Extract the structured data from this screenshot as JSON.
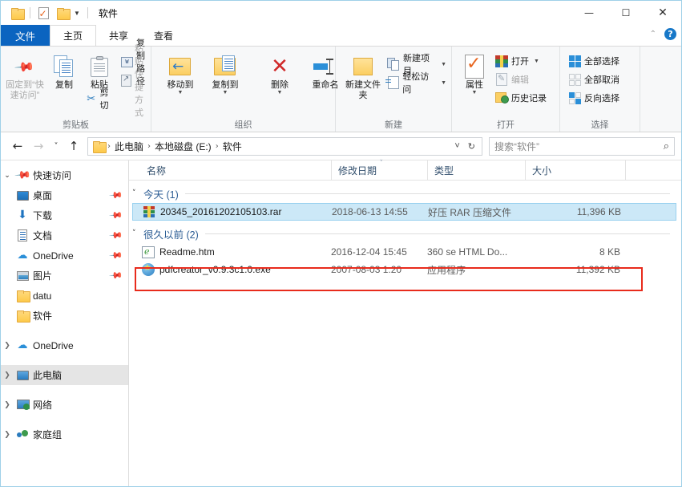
{
  "window": {
    "title": "软件",
    "quick_access": [
      {
        "name": "folder-icon",
        "label": "文件夹"
      },
      {
        "name": "properties-icon",
        "label": "属性"
      },
      {
        "name": "folder-icon-2",
        "label": "新建文件夹"
      }
    ],
    "controls": {
      "minimize": "—",
      "maximize": "☐",
      "close": "✕"
    }
  },
  "tabs": [
    {
      "label": "文件",
      "kind": "file"
    },
    {
      "label": "主页",
      "kind": "active"
    },
    {
      "label": "共享",
      "kind": "normal"
    },
    {
      "label": "查看",
      "kind": "normal"
    }
  ],
  "tab_right": {
    "collapse": "⌃",
    "help": "?"
  },
  "ribbon": {
    "groups": [
      {
        "title": "剪贴板",
        "big": [
          {
            "label": "固定到“快速访问”",
            "icon": "pin-icon",
            "disabled": true
          },
          {
            "label": "复制",
            "icon": "copy-icon",
            "disabled": false
          },
          {
            "label": "粘贴",
            "icon": "paste-icon",
            "disabled": false
          }
        ],
        "small": [
          {
            "label": "复制路径",
            "icon": "copy-path-icon",
            "disabled": false
          },
          {
            "label": "粘贴快捷方式",
            "icon": "paste-shortcut-icon",
            "disabled": true
          }
        ],
        "extra": [
          {
            "label": "剪切",
            "icon": "scissors-icon",
            "disabled": false
          }
        ]
      },
      {
        "title": "组织",
        "big": [
          {
            "label": "移动到",
            "icon": "move-to-icon",
            "dropdown": true
          },
          {
            "label": "复制到",
            "icon": "copy-to-icon",
            "dropdown": true
          },
          {
            "label": "删除",
            "icon": "delete-icon",
            "dropdown": true
          },
          {
            "label": "重命名",
            "icon": "rename-icon",
            "dropdown": false
          }
        ]
      },
      {
        "title": "新建",
        "big": [
          {
            "label": "新建文件夹",
            "icon": "new-folder-icon"
          }
        ],
        "small": [
          {
            "label": "新建项目",
            "icon": "new-item-icon",
            "dropdown": true
          },
          {
            "label": "轻松访问",
            "icon": "easy-access-icon",
            "dropdown": true
          }
        ]
      },
      {
        "title": "打开",
        "big": [
          {
            "label": "属性",
            "icon": "properties-icon",
            "dropdown": true
          }
        ],
        "small": [
          {
            "label": "打开",
            "icon": "open-archive-icon",
            "dropdown": true,
            "disabled": false
          },
          {
            "label": "编辑",
            "icon": "edit-icon",
            "disabled": true
          },
          {
            "label": "历史记录",
            "icon": "history-icon",
            "disabled": false
          }
        ]
      },
      {
        "title": "选择",
        "small": [
          {
            "label": "全部选择",
            "icon": "select-all-icon"
          },
          {
            "label": "全部取消",
            "icon": "select-none-icon"
          },
          {
            "label": "反向选择",
            "icon": "invert-selection-icon"
          }
        ]
      }
    ]
  },
  "addressbar": {
    "back": "←",
    "forward": "→",
    "recent": "˅",
    "up": "↑",
    "breadcrumbs": [
      "此电脑",
      "本地磁盘 (E:)",
      "软件"
    ],
    "separator": "›",
    "dropdown": "˅",
    "refresh": "↻",
    "search_placeholder": "搜索“软件”",
    "search_value": "",
    "search_icon": "⌕"
  },
  "sidebar": {
    "items": [
      {
        "label": "快速访问",
        "icon": "quick-access-icon",
        "expander": "open",
        "indent": 0,
        "pinned": false,
        "selected": false
      },
      {
        "label": "桌面",
        "icon": "desktop-icon",
        "expander": "none",
        "indent": 1,
        "pinned": true,
        "selected": false
      },
      {
        "label": "下载",
        "icon": "downloads-icon",
        "expander": "none",
        "indent": 1,
        "pinned": true,
        "selected": false
      },
      {
        "label": "文档",
        "icon": "documents-icon",
        "expander": "none",
        "indent": 1,
        "pinned": true,
        "selected": false
      },
      {
        "label": "OneDrive",
        "icon": "onedrive-icon",
        "expander": "none",
        "indent": 1,
        "pinned": true,
        "selected": false
      },
      {
        "label": "图片",
        "icon": "pictures-icon",
        "expander": "none",
        "indent": 1,
        "pinned": true,
        "selected": false
      },
      {
        "label": "datu",
        "icon": "folder-icon",
        "expander": "none",
        "indent": 1,
        "pinned": false,
        "selected": false
      },
      {
        "label": "软件",
        "icon": "folder-icon",
        "expander": "none",
        "indent": 1,
        "pinned": false,
        "selected": false
      },
      {
        "label": "OneDrive",
        "icon": "onedrive-icon",
        "expander": "closed",
        "indent": 0,
        "pinned": false,
        "selected": false
      },
      {
        "label": "此电脑",
        "icon": "this-pc-icon",
        "expander": "closed",
        "indent": 0,
        "pinned": false,
        "selected": true
      },
      {
        "label": "网络",
        "icon": "network-icon",
        "expander": "closed",
        "indent": 0,
        "pinned": false,
        "selected": false
      },
      {
        "label": "家庭组",
        "icon": "homegroup-icon",
        "expander": "closed",
        "indent": 0,
        "pinned": false,
        "selected": false
      }
    ]
  },
  "filelist": {
    "columns": [
      {
        "label": "名称",
        "sorted": false
      },
      {
        "label": "修改日期",
        "sorted": true
      },
      {
        "label": "类型",
        "sorted": false
      },
      {
        "label": "大小",
        "sorted": false
      }
    ],
    "sort_glyph": "˅",
    "group_chevron": "˅",
    "groups": [
      {
        "label": "今天 (1)",
        "rows": [
          {
            "name": "20345_20161202105103.rar",
            "date": "2018-06-13 14:55",
            "type": "好压 RAR 压缩文件",
            "size": "11,396 KB",
            "icon": "rar-archive-icon",
            "selected": true,
            "highlighted": false
          }
        ]
      },
      {
        "label": "很久以前 (2)",
        "rows": [
          {
            "name": "Readme.htm",
            "date": "2016-12-04 15:45",
            "type": "360 se HTML Do...",
            "size": "8 KB",
            "icon": "html-document-icon",
            "selected": false,
            "highlighted": false
          },
          {
            "name": "pdfcreator_v0.9.3c1.0.exe",
            "date": "2007-08-03 1:20",
            "type": "应用程序",
            "size": "11,392 KB",
            "icon": "application-exe-icon",
            "selected": false,
            "highlighted": true
          }
        ]
      }
    ]
  },
  "annotation": {
    "color": "#e82b1c",
    "target": "pdfcreator_v0.9.3c1.0.exe"
  }
}
